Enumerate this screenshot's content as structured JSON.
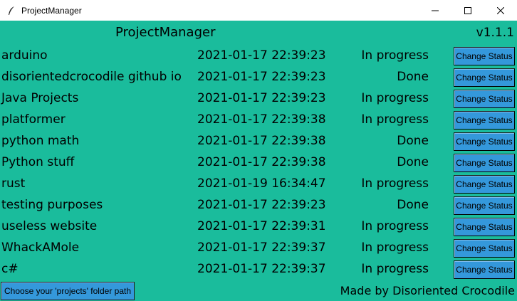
{
  "window": {
    "title": "ProjectManager",
    "controls": [
      "minimize",
      "maximize",
      "close"
    ]
  },
  "header": {
    "title": "ProjectManager",
    "version": "v1.1.1"
  },
  "projects": [
    {
      "name": "arduino",
      "date": "2021-01-17 22:39:23",
      "status": "In progress",
      "button": "Change Status"
    },
    {
      "name": "disorientedcrocodile github io",
      "date": "2021-01-17 22:39:23",
      "status": "Done",
      "button": "Change Status"
    },
    {
      "name": "Java Projects",
      "date": "2021-01-17 22:39:23",
      "status": "In progress",
      "button": "Change Status"
    },
    {
      "name": "platformer",
      "date": "2021-01-17 22:39:38",
      "status": "In progress",
      "button": "Change Status"
    },
    {
      "name": "python math",
      "date": "2021-01-17 22:39:38",
      "status": "Done",
      "button": "Change Status"
    },
    {
      "name": "Python stuff",
      "date": "2021-01-17 22:39:38",
      "status": "Done",
      "button": "Change Status"
    },
    {
      "name": "rust",
      "date": "2021-01-19 16:34:47",
      "status": "In progress",
      "button": "Change Status"
    },
    {
      "name": "testing purposes",
      "date": "2021-01-17 22:39:23",
      "status": "Done",
      "button": "Change Status"
    },
    {
      "name": "useless website",
      "date": "2021-01-17 22:39:31",
      "status": "In progress",
      "button": "Change Status"
    },
    {
      "name": "WhackAMole",
      "date": "2021-01-17 22:39:37",
      "status": "In progress",
      "button": "Change Status"
    },
    {
      "name": "c#",
      "date": "2021-01-17 22:39:37",
      "status": "In progress",
      "button": "Change Status"
    }
  ],
  "footer": {
    "folder_button": "Choose your 'projects' folder path",
    "credit": "Made by Disoriented Crocodile"
  },
  "colors": {
    "background": "#1abc9c",
    "button": "#3498db"
  }
}
